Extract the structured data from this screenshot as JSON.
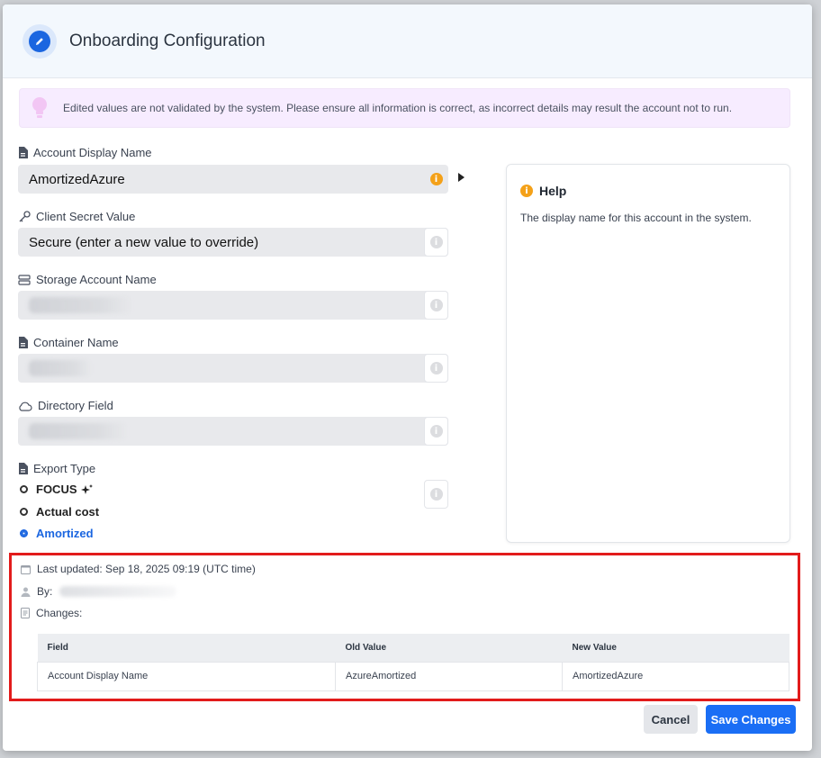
{
  "dialog": {
    "title": "Onboarding Configuration",
    "warning": "Edited values are not validated by the system. Please ensure all information is correct, as incorrect details may result the account not to run."
  },
  "fields": {
    "account_display_name": {
      "label": "Account Display Name",
      "value": "AmortizedAzure"
    },
    "client_secret_value": {
      "label": "Client Secret Value",
      "value": "Secure (enter a new value to override)"
    },
    "storage_account_name": {
      "label": "Storage Account Name"
    },
    "container_name": {
      "label": "Container Name"
    },
    "directory_field": {
      "label": "Directory Field"
    },
    "export_type": {
      "label": "Export Type",
      "options": [
        {
          "label": "FOCUS",
          "selected": false
        },
        {
          "label": "Actual cost",
          "selected": false
        },
        {
          "label": "Amortized",
          "selected": true
        }
      ]
    }
  },
  "help": {
    "title": "Help",
    "text": "The display name for this account in the system."
  },
  "history": {
    "last_updated": "Last updated: Sep 18, 2025 09:19 (UTC time)",
    "by_label": "By:",
    "changes_label": "Changes:",
    "table": {
      "columns": [
        "Field",
        "Old Value",
        "New Value"
      ],
      "rows": [
        [
          "Account Display Name",
          "AzureAmortized",
          "AmortizedAzure"
        ]
      ]
    }
  },
  "actions": {
    "cancel": "Cancel",
    "save": "Save Changes"
  },
  "colors": {
    "accent": "#1a6ef5",
    "highlight_border": "#e21b1b",
    "warning_bg": "#f7ecff",
    "info_orange": "#f4a119"
  }
}
